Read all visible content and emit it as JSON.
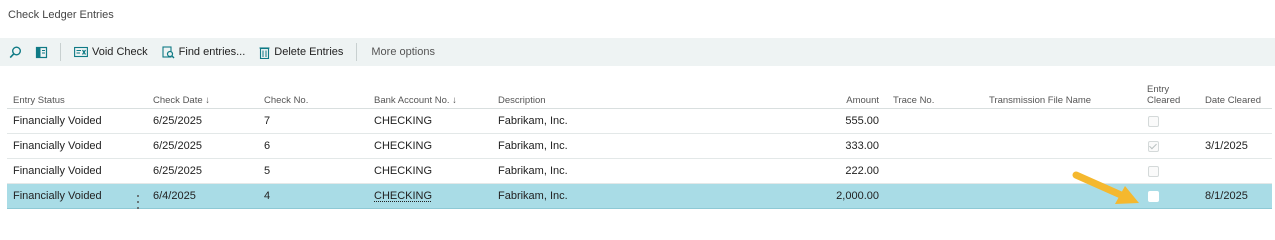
{
  "page": {
    "title": "Check Ledger Entries"
  },
  "toolbar": {
    "void_check": "Void Check",
    "find_entries": "Find entries...",
    "delete_entries": "Delete Entries",
    "more_options": "More options"
  },
  "table": {
    "columns": [
      "Entry Status",
      "Check Date ↓",
      "Check No.",
      "Bank Account No. ↓",
      "Description",
      "Amount",
      "Trace No.",
      "Transmission File Name",
      "Entry Cleared",
      "Date Cleared"
    ],
    "rows": [
      {
        "entry_status": "Financially Voided",
        "check_date": "6/25/2025",
        "check_no": "7",
        "bank_account_no": "CHECKING",
        "description": "Fabrikam, Inc.",
        "amount": "555.00",
        "trace_no": "",
        "transmission_file_name": "",
        "entry_cleared": false,
        "date_cleared": ""
      },
      {
        "entry_status": "Financially Voided",
        "check_date": "6/25/2025",
        "check_no": "6",
        "bank_account_no": "CHECKING",
        "description": "Fabrikam, Inc.",
        "amount": "333.00",
        "trace_no": "",
        "transmission_file_name": "",
        "entry_cleared": true,
        "date_cleared": "3/1/2025"
      },
      {
        "entry_status": "Financially Voided",
        "check_date": "6/25/2025",
        "check_no": "5",
        "bank_account_no": "CHECKING",
        "description": "Fabrikam, Inc.",
        "amount": "222.00",
        "trace_no": "",
        "transmission_file_name": "",
        "entry_cleared": false,
        "date_cleared": ""
      },
      {
        "entry_status": "Financially Voided",
        "check_date": "6/4/2025",
        "check_no": "4",
        "bank_account_no": "CHECKING",
        "description": "Fabrikam, Inc.",
        "amount": "2,000.00",
        "trace_no": "",
        "transmission_file_name": "",
        "entry_cleared": false,
        "date_cleared": "8/1/2025"
      }
    ]
  },
  "colors": {
    "toolbar_bg": "#eef3f3",
    "selected_row": "#a9dce6",
    "accent": "#0f7a85",
    "arrow": "#f5b82e"
  },
  "icons": [
    "search-icon",
    "filter-pane-icon",
    "void-check-icon",
    "find-entries-icon",
    "delete-entries-icon",
    "kebab-icon",
    "arrow-annotation-icon"
  ]
}
